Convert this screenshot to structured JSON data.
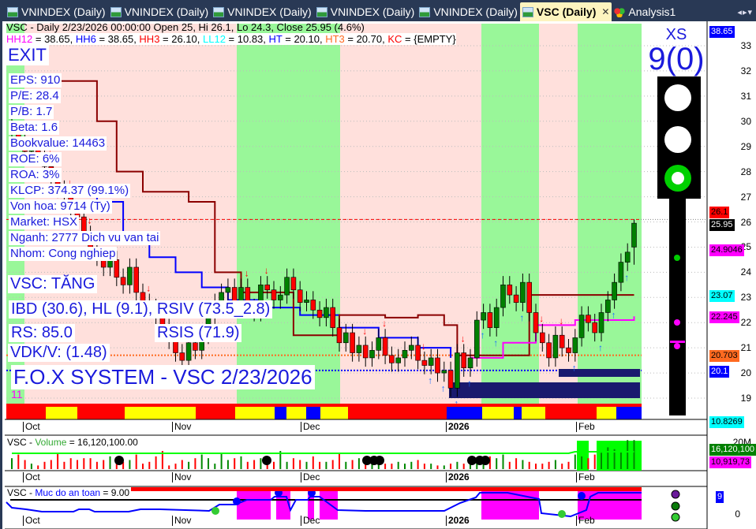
{
  "tabs": [
    {
      "label": "VNINDEX (Daily)"
    },
    {
      "label": "VNINDEX (Daily)"
    },
    {
      "label": "VNINDEX (Daily)"
    },
    {
      "label": "VNINDEX (Daily)"
    },
    {
      "label": "VNINDEX (Daily)"
    },
    {
      "label": "VSC (Daily)",
      "active": true
    },
    {
      "label": "Analysis1"
    }
  ],
  "header": {
    "line1": "VSC - Daily 2/23/2026 00:00:00 Open 25, Hi 26.1, Lo 24.3, Close 25.95 (4.6%)",
    "hh12": "HH12",
    "hh12v": " = 38.65, ",
    "hh6": "HH6",
    "hh6v": " = 38.65, ",
    "hh3": "HH3",
    "hh3v": " = 26.10, ",
    "ll12": "LL12",
    "ll12v": " = 10.83, ",
    "ht": "HT",
    "htv": "  = 20.10, ",
    "ht3": "HT3",
    "ht3v": "  = 20.70, ",
    "kc": "KC",
    "kcv": " = {EMPTY}"
  },
  "signal": {
    "exit": "EXIT",
    "xs": "XS",
    "score": "9(0)",
    "trend": "VSC: TĂNG",
    "ibd": "IBD (30.6), HL (9.1), RSIV (73.5_2.8)",
    "rs": "RS: 85.0",
    "rsis": "RSIS (71.9)",
    "vdk": "VDK/V:  (1.48)",
    "system": "F.O.X SYSTEM - VSC 2/23/2026",
    "count": "11"
  },
  "fundamentals": [
    "EPS: 910",
    "P/E: 28.4",
    "P/B: 1.7",
    "Beta: 1.6",
    "Bookvalue: 14463",
    "ROE: 6%",
    "ROA: 3%",
    "KLCP: 374.37 (99.1%)",
    "Von hoa: 9714 (Ty)",
    "Market: HSX",
    "Nganh: 2777 Dich vu van tai",
    "Nhom: Cong nghiep"
  ],
  "price_axis": {
    "ticks": [
      "33",
      "32",
      "31",
      "30",
      "29",
      "28",
      "27",
      "26",
      "25",
      "24",
      "23",
      "22",
      "21",
      "20",
      "19"
    ],
    "tags": [
      {
        "v": "38.65",
        "bg": "#0000ff",
        "fg": "#fff"
      },
      {
        "v": "26.1",
        "bg": "#ff0000",
        "fg": "#000"
      },
      {
        "v": "25.95",
        "bg": "#000",
        "fg": "#fff"
      },
      {
        "v": "24.9046",
        "bg": "#ff00ff",
        "fg": "#000"
      },
      {
        "v": "23.07",
        "bg": "#00ffff",
        "fg": "#000"
      },
      {
        "v": "22.245",
        "bg": "#ff00ff",
        "fg": "#000"
      },
      {
        "v": "20.703",
        "bg": "#ff6a20",
        "fg": "#000"
      },
      {
        "v": "20.1",
        "bg": "#0000ff",
        "fg": "#fff"
      },
      {
        "v": "10.8269",
        "bg": "#00ffff",
        "fg": "#000"
      }
    ]
  },
  "months": [
    "Oct",
    "Nov",
    "Dec",
    "2026",
    "Feb"
  ],
  "volume": {
    "title_prefix": "VSC - ",
    "title_name": "Volume",
    "title_value": " = 16,120,100.00",
    "axis_tick": "20M",
    "tags": [
      "16,120,100",
      "10,919,73"
    ]
  },
  "safety": {
    "title_prefix": "VSC - ",
    "title_name": "Muc do an toan",
    "title_value": " = 9.00",
    "tag": "9",
    "axis_tick": "0"
  },
  "colors": {
    "up": "#008000",
    "down": "#ff0000",
    "green_zone": "#99f799",
    "pink_zone": "#ffe0dc",
    "accent": "#1a1adc"
  },
  "chart_data": {
    "type": "candlestick",
    "title": "VSC - Daily",
    "ylim": [
      18.5,
      33.5
    ],
    "close": [
      29.5,
      29.2,
      28.8,
      29,
      28.6,
      28.2,
      27.6,
      27.3,
      27,
      26.5,
      26.2,
      25.5,
      25,
      24.6,
      24.2,
      24.5,
      23.8,
      23.5,
      24.2,
      23.2,
      22.8,
      22.6,
      22.2,
      21.8,
      21.3,
      20.8,
      20.5,
      21.2,
      20.9,
      21.5,
      22.3,
      22.8,
      23.2,
      23.4,
      22.8,
      23.4,
      22.6,
      22.4,
      23.5,
      23.3,
      22.9,
      23.1,
      23.8,
      23.3,
      22.8,
      22.9,
      22.5,
      22.2,
      22.6,
      21.8,
      21.2,
      21.6,
      20.8,
      21.1,
      20.6,
      20.9,
      21.4,
      20.7,
      20.4,
      20.6,
      20.9,
      21.1,
      20.5,
      20.3,
      20.6,
      20.0,
      20.1,
      19.4,
      20.8,
      20.2,
      20.6,
      22.1,
      22.4,
      21.8,
      22.6,
      23.5,
      23.1,
      22.8,
      23.6,
      22.4,
      21.6,
      21.2,
      20.6,
      21.5,
      21.0,
      20.8,
      21.4,
      22.3,
      22.0,
      21.6,
      22.4,
      22.9,
      23.6,
      24.4,
      24.8,
      25.95
    ],
    "last_bar": {
      "open": 25,
      "high": 26.1,
      "low": 24.3,
      "close": 25.95
    },
    "stop_line": [
      [
        2,
        31.6
      ],
      [
        11,
        31.6
      ],
      [
        13,
        30
      ],
      [
        16,
        28
      ],
      [
        20,
        27.2
      ],
      [
        23,
        27.2
      ],
      [
        27,
        26.8
      ],
      [
        31,
        24
      ],
      [
        35,
        23.2
      ],
      [
        40,
        23.2
      ],
      [
        43,
        21.5
      ],
      [
        50,
        22.3
      ],
      [
        57,
        22.2
      ],
      [
        62,
        22.3
      ],
      [
        66,
        21.9
      ],
      [
        68,
        20.7
      ],
      [
        72,
        20.7
      ],
      [
        79,
        23.1
      ],
      [
        95,
        23.1
      ]
    ],
    "trail_line": [
      [
        9,
        27.4
      ],
      [
        13,
        26.8
      ],
      [
        17,
        25.6
      ],
      [
        21,
        24.6
      ],
      [
        25,
        24
      ],
      [
        29,
        23.4
      ],
      [
        33,
        22.9
      ],
      [
        38,
        22.6
      ],
      [
        44,
        22.3
      ],
      [
        50,
        21.8
      ],
      [
        56,
        21.4
      ],
      [
        62,
        21
      ],
      [
        67,
        20.6
      ]
    ],
    "ma_line": [
      [
        70,
        20.6
      ],
      [
        75,
        21.2
      ],
      [
        80,
        21.9
      ],
      [
        86,
        22.1
      ],
      [
        95,
        22.25
      ]
    ],
    "levels": {
      "hh3": 26.1,
      "ht3": 20.703,
      "ht": 20.1
    },
    "volume_m": [
      6,
      8,
      5,
      3,
      2,
      4,
      5,
      9,
      4,
      6,
      5,
      6,
      6,
      4,
      5,
      7,
      6,
      4,
      5,
      8,
      3,
      4,
      7,
      10,
      2,
      3,
      5,
      4,
      6,
      8,
      6,
      3,
      9,
      5,
      6,
      7,
      4,
      5,
      6,
      5,
      4,
      10,
      4,
      6,
      5,
      4,
      7,
      4,
      4,
      5,
      9,
      4,
      5,
      6,
      4,
      4,
      7,
      3,
      3,
      4,
      3,
      4,
      5,
      3,
      3,
      2,
      2,
      3,
      4,
      3,
      4,
      5,
      6,
      7,
      6,
      8,
      4,
      6,
      5,
      4,
      3,
      3,
      4,
      5,
      3,
      4,
      8,
      7,
      6,
      8,
      9,
      12,
      11,
      10,
      16,
      16
    ],
    "safety_score": 9
  }
}
